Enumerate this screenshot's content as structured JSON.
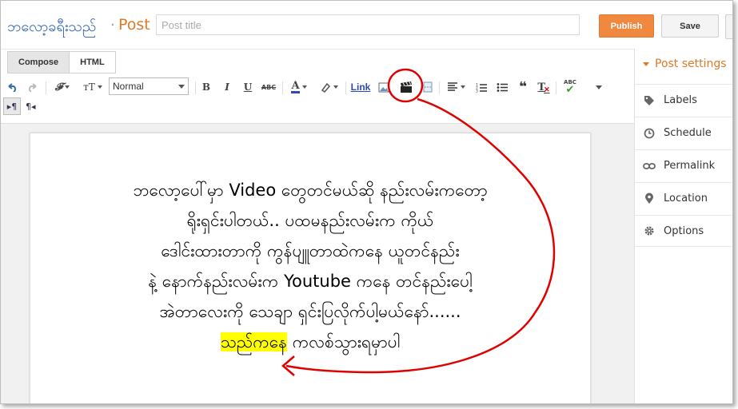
{
  "header": {
    "blog_name": "ဘလော့ခရီးသည်",
    "separator": "·",
    "crumb": "Post",
    "title_placeholder": "Post title",
    "publish_label": "Publish",
    "save_label": "Save"
  },
  "modes": {
    "compose_label": "Compose",
    "html_label": "HTML"
  },
  "toolbar": {
    "undo_icon": "undo-icon",
    "redo_icon": "redo-icon",
    "font_family_glyph": "𝓕",
    "font_size_glyph": "тT",
    "format_value": "Normal",
    "bold": "B",
    "italic": "I",
    "underline": "U",
    "strike": "ABC",
    "text_color": "A",
    "link_label": "Link",
    "quote_glyph": "❝",
    "clear_glyph": "T",
    "spell_glyph": "ABC",
    "ltr_glyph": "▸¶",
    "rtl_glyph": "¶◂"
  },
  "content": {
    "lines": [
      "ဘလော့ပေါ်မှာ Video တွေတင်မယ်ဆို နည်းလမ်းကတော့",
      "ရိုးရှင်းပါတယ်.. ပထမနည်းလမ်းက ကိုယ်",
      "ဒေါင်းထားတာကို ကွန်ပျူတာထဲကနေ ယူတင်နည်း",
      "နဲ့ နောက်နည်းလမ်းက Youtube ကနေ တင်နည်းပေါ့",
      "အဲတာလေးကို သေချာ ရှင်းပြလိုက်ပါ့မယ်နော်......"
    ],
    "last_highlight": "သည်ကနေ",
    "last_rest": " ကလစ်သွားရမှာပါ"
  },
  "sidebar": {
    "heading": "Post settings",
    "items": [
      {
        "label": "Labels",
        "icon": "tag-icon"
      },
      {
        "label": "Schedule",
        "icon": "clock-icon"
      },
      {
        "label": "Permalink",
        "icon": "link-icon"
      },
      {
        "label": "Location",
        "icon": "pin-icon"
      },
      {
        "label": "Options",
        "icon": "gear-icon"
      }
    ]
  },
  "colors": {
    "accent": "#dd7a2a",
    "publish": "#f0883f",
    "blog_name": "#2a5db0",
    "annotation": "#e00000",
    "highlight": "#ffff00"
  }
}
